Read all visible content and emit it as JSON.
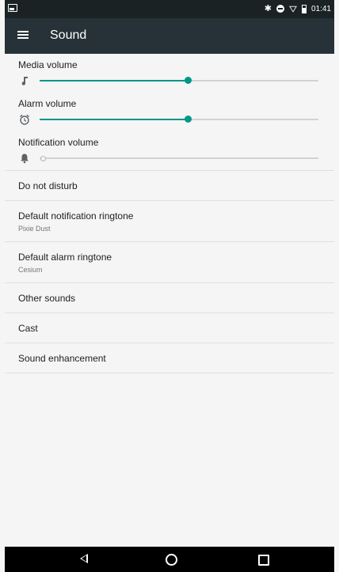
{
  "status_bar": {
    "time": "01:41",
    "icons": [
      "notification-icon",
      "bluetooth-icon",
      "dnd-icon",
      "wifi-icon",
      "battery-icon"
    ]
  },
  "app_bar": {
    "title": "Sound",
    "menu_icon": "menu-icon"
  },
  "volume_sliders": [
    {
      "label": "Media volume",
      "icon": "music-note-icon",
      "level": 0.53
    },
    {
      "label": "Alarm volume",
      "icon": "alarm-icon",
      "level": 0.53
    },
    {
      "label": "Notification volume",
      "icon": "bell-icon",
      "level": 0.0
    }
  ],
  "settings_items": [
    {
      "title": "Do not disturb"
    },
    {
      "title": "Default notification ringtone",
      "subtitle": "Pixie Dust"
    },
    {
      "title": "Default alarm ringtone",
      "subtitle": "Cesium"
    },
    {
      "title": "Other sounds"
    },
    {
      "title": "Cast"
    },
    {
      "title": "Sound enhancement"
    }
  ],
  "nav_bar": {
    "icons": [
      "back-icon",
      "home-icon",
      "recents-icon"
    ]
  },
  "colors": {
    "accent": "#009688",
    "app_bar": "#263238",
    "status_bar": "#1b2224"
  }
}
